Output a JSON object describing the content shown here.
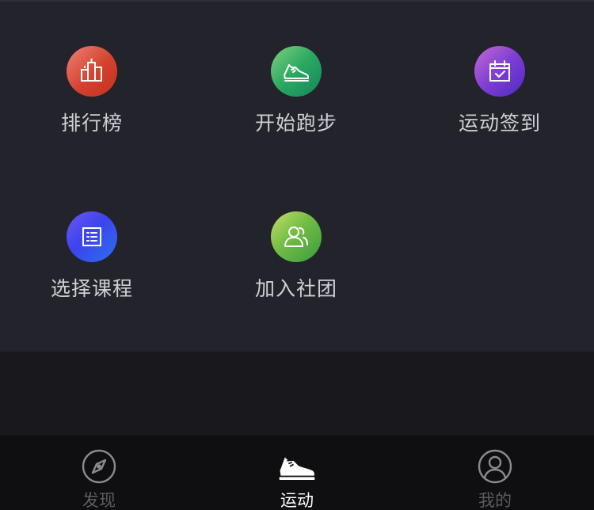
{
  "grid": {
    "items": [
      {
        "label": "排行榜",
        "icon": "ranking-podium-icon"
      },
      {
        "label": "开始跑步",
        "icon": "running-shoe-icon"
      },
      {
        "label": "运动签到",
        "icon": "calendar-check-icon"
      },
      {
        "label": "选择课程",
        "icon": "course-list-icon"
      },
      {
        "label": "加入社团",
        "icon": "club-people-icon"
      }
    ]
  },
  "tabbar": {
    "tabs": [
      {
        "label": "发现",
        "icon": "compass-icon",
        "active": false
      },
      {
        "label": "运动",
        "icon": "sneaker-icon",
        "active": true
      },
      {
        "label": "我的",
        "icon": "user-profile-icon",
        "active": false
      }
    ]
  },
  "colors": {
    "panel_bg": "#23232c",
    "tabbar_bg": "#0f0f12",
    "label_text": "#cfcfd4",
    "tab_inactive": "#5b5b62",
    "tab_active": "#ffffff"
  }
}
